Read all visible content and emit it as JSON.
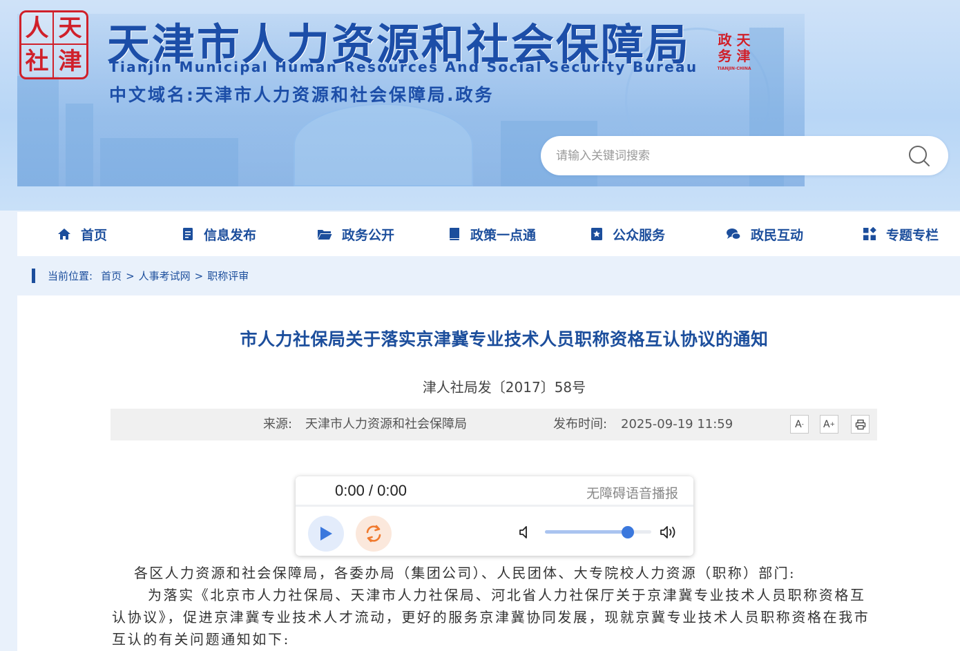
{
  "header": {
    "logo_chars": [
      "人",
      "天",
      "社",
      "津"
    ],
    "title_cn": "天津市人力资源和社会保障局",
    "title_en": "Tianjin Municipal Human Resources And Social Security Bureau",
    "domain_name": "中文域名:天津市人力资源和社会保障局.政务",
    "seal_chars": [
      "政",
      "天",
      "务",
      "津"
    ],
    "seal_caption": "TIANJIN·CHINA"
  },
  "search": {
    "placeholder": "请输入关键词搜索",
    "value": "",
    "icon": "search-icon"
  },
  "nav": {
    "items": [
      {
        "label": "首页",
        "icon": "home-icon"
      },
      {
        "label": "信息发布",
        "icon": "document-icon"
      },
      {
        "label": "政务公开",
        "icon": "folder-icon"
      },
      {
        "label": "政策一点通",
        "icon": "book-icon"
      },
      {
        "label": "公众服务",
        "icon": "bookmark-icon"
      },
      {
        "label": "政民互动",
        "icon": "chat-icon"
      },
      {
        "label": "专题专栏",
        "icon": "grid-icon"
      }
    ]
  },
  "breadcrumb": {
    "label": "当前位置:",
    "items": [
      "首页",
      "人事考试网",
      "职称评审"
    ],
    "separator": ">"
  },
  "article": {
    "title": "市人力社保局关于落实京津冀专业技术人员职称资格互认协议的通知",
    "doc_number": "津人社局发〔2017〕58号",
    "source_label": "来源:",
    "source": "天津市人力资源和社会保障局",
    "time_label": "发布时间:",
    "time": "2025-09-19 11:59",
    "font_decrease": "A",
    "font_increase": "A",
    "paragraphs": [
      "各区人力资源和社会保障局，各委办局（集团公司）、人民团体、大专院校人力资源（职称）部门:",
      "为落实《北京市人力社保局、天津市人力社保局、河北省人力社保厅关于京津冀专业技术人员职称资格互认协议》，促进京津冀专业技术人才流动，更好的服务京津冀协同发展，现就京冀专业技术人员职称资格在我市互认的有关问题通知如下:"
    ]
  },
  "player": {
    "time_display": "0:00 / 0:00",
    "label": "无障碍语音播报",
    "volume": 0.78
  },
  "colors": {
    "brand_blue": "#1c4e9c",
    "logo_red": "#d0202a",
    "play_blue": "#3b78dd",
    "loop_orange": "#f07a2f"
  }
}
